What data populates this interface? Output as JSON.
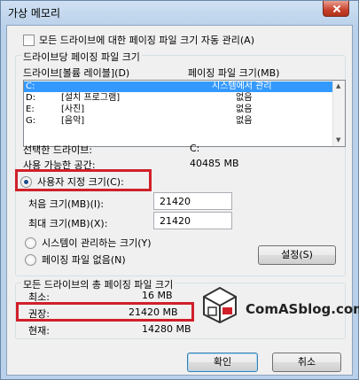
{
  "window": {
    "title": "가상 메모리"
  },
  "auto_manage": {
    "label": "모든 드라이브에 대한 페이징 파일 크기 자동 관리(A)",
    "checked": false
  },
  "drive_group": {
    "title": "드라이브당 페이징 파일 크기",
    "col_drive": "드라이브[볼륨 레이블](D)",
    "col_size": "페이징 파일 크기(MB)",
    "rows": [
      {
        "drive": "C:",
        "label": "",
        "size": "시스템에서 관리"
      },
      {
        "drive": "D:",
        "label": "[설치 프로그램]",
        "size": "없음"
      },
      {
        "drive": "E:",
        "label": "[사진]",
        "size": "없음"
      },
      {
        "drive": "G:",
        "label": "[음악]",
        "size": "없음"
      }
    ],
    "selected_drive_label": "선택한 드라이브:",
    "selected_drive_value": "C:",
    "free_space_label": "사용 가능한 공간:",
    "free_space_value": "40485 MB",
    "custom_size_label": "사용자 지정 크기(C):",
    "initial_size_label": "처음 크기(MB)(I):",
    "initial_size_value": "21420",
    "max_size_label": "최대 크기(MB)(X):",
    "max_size_value": "21420",
    "system_managed_label": "시스템이 관리하는 크기(Y)",
    "no_paging_label": "페이징 파일 없음(N)",
    "set_button": "설정(S)"
  },
  "total_group": {
    "title": "모든 드라이브의 총 페이징 파일 크기",
    "min_label": "최소:",
    "min_value": "16 MB",
    "recommended_label": "권장:",
    "recommended_value": "21420 MB",
    "current_label": "현재:",
    "current_value": "14280 MB"
  },
  "watermark": {
    "text": "ComASblog.com"
  },
  "buttons": {
    "ok": "확인",
    "cancel": "취소"
  },
  "colors": {
    "highlight": "#d0202a",
    "selection": "#3399ff"
  }
}
